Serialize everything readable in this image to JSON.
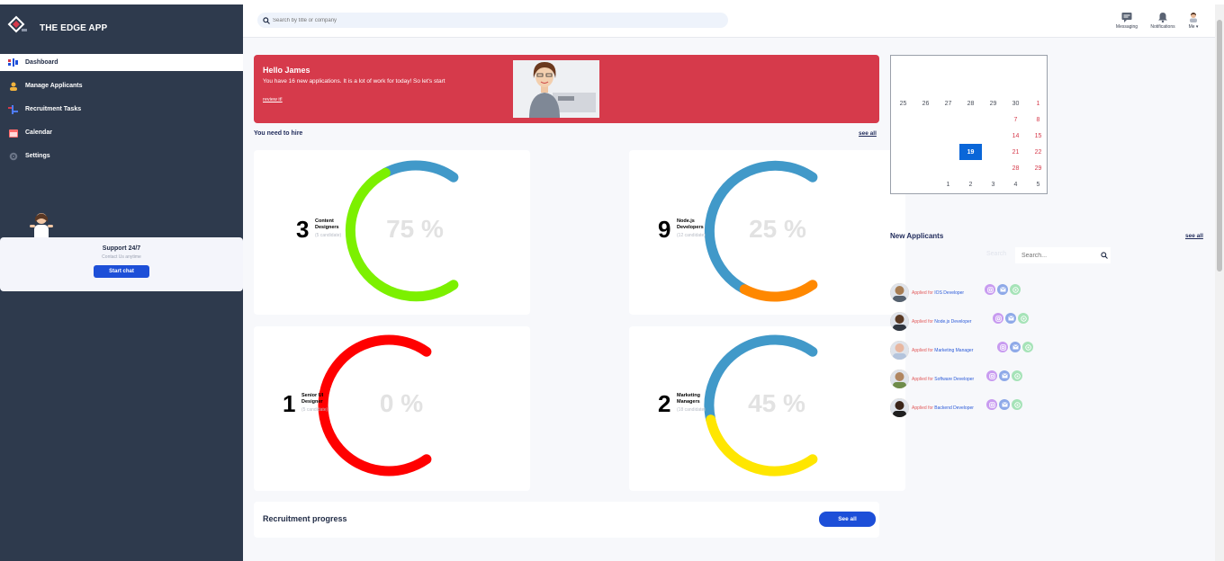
{
  "app": {
    "name": "THE EDGE APP"
  },
  "sidebar": {
    "items": [
      {
        "label": "Dashboard",
        "icon": "dashboard-icon",
        "active": true
      },
      {
        "label": "Manage Applicants",
        "icon": "applicants-icon",
        "active": false
      },
      {
        "label": "Recruitment Tasks",
        "icon": "tasks-icon",
        "active": false
      },
      {
        "label": "Calendar",
        "icon": "calendar-icon",
        "active": false
      },
      {
        "label": "Settings",
        "icon": "gear-icon",
        "active": false
      }
    ],
    "support": {
      "title": "Support 24/7",
      "subtitle": "Contact Us anytime",
      "button": "Start chat"
    }
  },
  "header": {
    "search_placeholder": "Search by title or company",
    "actions": [
      {
        "label": "Messaging",
        "icon": "message-icon"
      },
      {
        "label": "Notifications",
        "icon": "bell-icon"
      },
      {
        "label": "Me",
        "icon": "avatar"
      }
    ]
  },
  "banner": {
    "title": "Hello James",
    "text": "You have 16 new applications. It is a lot of work for today! So let's start",
    "link": "review it!"
  },
  "hire": {
    "title": "You need to hire",
    "see_all": "see all",
    "cards": [
      {
        "count": "3",
        "role": "Content Designers",
        "candidates": "(5 candidate)",
        "percent_label": "75 %",
        "percent": 75,
        "color": "#7cf000"
      },
      {
        "count": "9",
        "role": "Node.js Developers",
        "candidates": "(12 candidate)",
        "percent_label": "25 %",
        "percent": 25,
        "color": "#ff8800"
      },
      {
        "count": "1",
        "role": "Senior UI Designer",
        "candidates": "(5 candidate)",
        "percent_label": "0 %",
        "percent": 0,
        "color": "#ff0000"
      },
      {
        "count": "2",
        "role": "Marketing Managers",
        "candidates": "(18 candidate)",
        "percent_label": "45 %",
        "percent": 45,
        "color": "#ffe600"
      }
    ],
    "track_color": "#4199c9"
  },
  "progress": {
    "title": "Recruitment progress",
    "button": "See all"
  },
  "calendar": {
    "rows": [
      [
        "25",
        "26",
        "27",
        "28",
        "29",
        "30",
        "1"
      ],
      [
        "",
        "",
        "",
        "",
        "",
        "7",
        "8"
      ],
      [
        "",
        "",
        "",
        "",
        "",
        "14",
        "15"
      ],
      [
        "",
        "",
        "",
        "19",
        "",
        "21",
        "22"
      ],
      [
        "",
        "",
        "",
        "",
        "",
        "28",
        "29"
      ],
      [
        "",
        "",
        "1",
        "2",
        "3",
        "4",
        "5"
      ]
    ],
    "selected": "19"
  },
  "applicants": {
    "title": "New Applicants",
    "see_all": "see all",
    "search_label": "Search",
    "search_placeholder": "Search...",
    "applied_prefix": "Applied for",
    "items": [
      {
        "role": "IOS Developer"
      },
      {
        "role": "Node.js Developer"
      },
      {
        "role": "Marketing Manager"
      },
      {
        "role": "Software Developer"
      },
      {
        "role": "Backend Developer"
      }
    ]
  }
}
